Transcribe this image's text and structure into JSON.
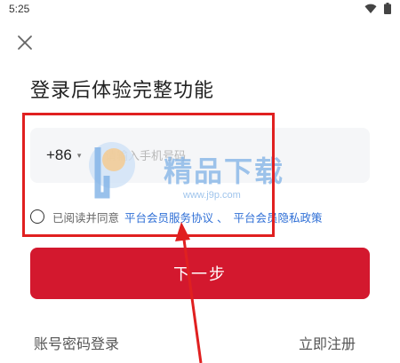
{
  "status_bar": {
    "time": "5:25",
    "icons": [
      "wifi-icon",
      "battery-icon"
    ]
  },
  "header": {
    "close_icon": "close-icon",
    "title": "登录后体验完整功能"
  },
  "phone": {
    "country_code": "+86",
    "country_caret": "▾",
    "placeholder": "请输入手机号码",
    "value": ""
  },
  "agreement": {
    "checked": false,
    "text": "已阅读并同意",
    "service_link": "平台会员服务协议",
    "separator": "、",
    "privacy_link": "平台会员隐私政策"
  },
  "next_button": {
    "label": "下一步"
  },
  "footer": {
    "account_login": "账号密码登录",
    "register": "立即注册"
  },
  "watermark": {
    "text": "精品下载",
    "url": "www.j9p.com"
  },
  "colors": {
    "primary": "#d3182e",
    "link": "#2f6fd6",
    "annotation": "#e02020",
    "input_bg": "#f5f6f8"
  }
}
